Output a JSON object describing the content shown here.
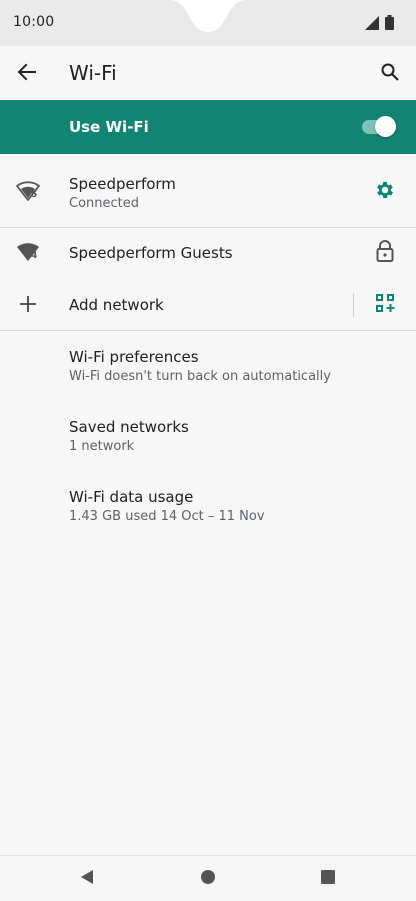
{
  "status_bar": {
    "time": "10:00",
    "icons": [
      "signal-icon",
      "battery-icon"
    ]
  },
  "app_bar": {
    "title": "Wi-Fi",
    "back_icon": "arrow-back-icon",
    "search_icon": "search-icon"
  },
  "master_switch": {
    "label": "Use Wi-Fi",
    "on": true,
    "accent_color": "#128474"
  },
  "networks": [
    {
      "name": "Speedperform",
      "status": "Connected",
      "wifi_badge": "5",
      "icon": "wifi-signal-icon",
      "action_icon": "settings-gear-icon"
    },
    {
      "name": "Speedperform Guests",
      "wifi_badge": "4",
      "icon": "wifi-signal-icon",
      "action_icon": "lock-icon"
    }
  ],
  "add_network": {
    "label": "Add network",
    "icon": "plus-icon",
    "qr_icon": "qr-scan-icon"
  },
  "settings": [
    {
      "title": "Wi-Fi preferences",
      "subtitle": "Wi-Fi doesn't turn back on automatically"
    },
    {
      "title": "Saved networks",
      "subtitle": "1 network"
    },
    {
      "title": "Wi-Fi data usage",
      "subtitle": "1.43 GB used 14 Oct – 11 Nov"
    }
  ],
  "nav_bar": {
    "back_icon": "nav-back-icon",
    "home_icon": "nav-home-icon",
    "recents_icon": "nav-recents-icon"
  }
}
